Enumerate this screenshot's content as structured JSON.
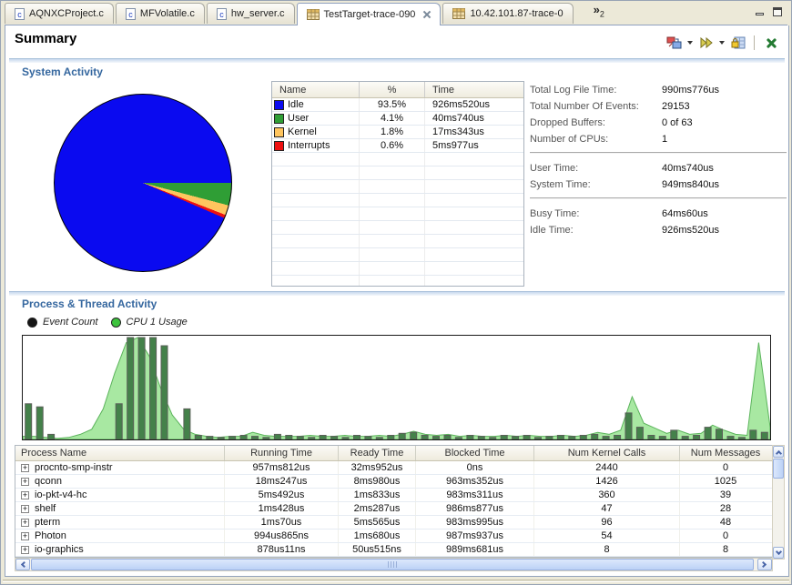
{
  "tab_bar": {
    "tabs": [
      {
        "label": "AQNXCProject.c",
        "icon": "c-file",
        "active": false,
        "closable": false
      },
      {
        "label": "MFVolatile.c",
        "icon": "c-file",
        "active": false,
        "closable": false
      },
      {
        "label": "hw_server.c",
        "icon": "c-file",
        "active": false,
        "closable": false
      },
      {
        "label": "TestTarget-trace-090",
        "icon": "trace",
        "active": true,
        "closable": true
      },
      {
        "label": "10.42.101.87-trace-0",
        "icon": "trace",
        "active": false,
        "closable": false
      }
    ],
    "overflow_count": "2"
  },
  "header": {
    "title": "Summary"
  },
  "system_activity": {
    "title": "System Activity",
    "legend_table": {
      "headers": [
        "Name",
        "%",
        "Time"
      ],
      "rows": [
        {
          "name": "Idle",
          "percent": "93.5%",
          "time": "926ms520us",
          "color": "#0a0af0"
        },
        {
          "name": "User",
          "percent": "4.1%",
          "time": "40ms740us",
          "color": "#2f9e35"
        },
        {
          "name": "Kernel",
          "percent": "1.8%",
          "time": "17ms343us",
          "color": "#ffc55e"
        },
        {
          "name": "Interrupts",
          "percent": "0.6%",
          "time": "5ms977us",
          "color": "#ee1010"
        }
      ],
      "empty_row_count": 10
    },
    "stats": {
      "groups": [
        [
          {
            "label": "Total Log File Time:",
            "value": "990ms776us"
          },
          {
            "label": "Total Number Of Events:",
            "value": "29153"
          },
          {
            "label": "Dropped Buffers:",
            "value": "0 of 63"
          },
          {
            "label": "Number of CPUs:",
            "value": "1"
          }
        ],
        [
          {
            "label": "User Time:",
            "value": "40ms740us"
          },
          {
            "label": "System Time:",
            "value": "949ms840us"
          }
        ],
        [
          {
            "label": "Busy Time:",
            "value": "64ms60us"
          },
          {
            "label": "Idle Time:",
            "value": "926ms520us"
          }
        ]
      ]
    }
  },
  "process_activity": {
    "title": "Process & Thread Activity",
    "legend": [
      {
        "label": "Event Count",
        "color": "#151515"
      },
      {
        "label": "CPU 1 Usage",
        "color": "#3ec43e"
      }
    ],
    "table": {
      "headers": [
        "Process Name",
        "Running Time",
        "Ready Time",
        "Blocked Time",
        "Num Kernel Calls",
        "Num Messages"
      ],
      "rows": [
        {
          "name": "procnto-smp-instr",
          "running": "957ms812us",
          "ready": "32ms952us",
          "blocked": "0ns",
          "kernel_calls": "2440",
          "messages": "0"
        },
        {
          "name": "qconn",
          "running": "18ms247us",
          "ready": "8ms980us",
          "blocked": "963ms352us",
          "kernel_calls": "1426",
          "messages": "1025"
        },
        {
          "name": "io-pkt-v4-hc",
          "running": "5ms492us",
          "ready": "1ms833us",
          "blocked": "983ms311us",
          "kernel_calls": "360",
          "messages": "39"
        },
        {
          "name": "shelf",
          "running": "1ms428us",
          "ready": "2ms287us",
          "blocked": "986ms877us",
          "kernel_calls": "47",
          "messages": "28"
        },
        {
          "name": "pterm",
          "running": "1ms70us",
          "ready": "5ms565us",
          "blocked": "983ms995us",
          "kernel_calls": "96",
          "messages": "48"
        },
        {
          "name": "Photon",
          "running": "994us865ns",
          "ready": "1ms680us",
          "blocked": "987ms937us",
          "kernel_calls": "54",
          "messages": "0"
        },
        {
          "name": "io-graphics",
          "running": "878us11ns",
          "ready": "50us515ns",
          "blocked": "989ms681us",
          "kernel_calls": "8",
          "messages": "8"
        }
      ]
    }
  },
  "chart_data": [
    {
      "type": "pie",
      "title": "System Activity CPU usage",
      "labels": [
        "Idle",
        "User",
        "Kernel",
        "Interrupts"
      ],
      "values": [
        93.5,
        4.1,
        1.8,
        0.6
      ],
      "colors": [
        "#0a0af0",
        "#2f9e35",
        "#ffc55e",
        "#ee1010"
      ],
      "unit": "%",
      "legend_position": "right-table",
      "start_angle_deg_from_east_clockwise": 0
    },
    {
      "type": "bar",
      "title": "Process & Thread Activity timeline",
      "note": "No axes or tick labels are visible; values are estimated percent of chart height over the trace timeline.",
      "ylim": [
        0,
        100
      ],
      "grid": false,
      "legend_position": "top-left",
      "series": [
        {
          "name": "Event Count",
          "type": "bar",
          "color": "#44814a",
          "values": [
            35,
            32,
            5,
            0,
            0,
            0,
            0,
            0,
            35,
            100,
            100,
            100,
            92,
            0,
            30,
            4,
            3,
            2,
            3,
            4,
            3,
            2,
            5,
            4,
            3,
            2,
            4,
            3,
            2,
            4,
            3,
            2,
            4,
            6,
            7,
            4,
            3,
            4,
            2,
            4,
            3,
            2,
            4,
            3,
            4,
            2,
            3,
            4,
            3,
            4,
            5,
            3,
            4,
            26,
            12,
            4,
            3,
            9,
            3,
            4,
            12,
            10,
            3,
            2,
            9,
            7
          ]
        },
        {
          "name": "CPU 1 Usage",
          "type": "area",
          "color": "#a8e8a2",
          "values": [
            3,
            3,
            2,
            1,
            2,
            5,
            10,
            30,
            65,
            95,
            100,
            82,
            50,
            24,
            10,
            5,
            3,
            2,
            3,
            3,
            7,
            4,
            3,
            3,
            3,
            4,
            3,
            3,
            4,
            3,
            3,
            4,
            3,
            5,
            8,
            5,
            4,
            5,
            3,
            4,
            3,
            3,
            4,
            3,
            4,
            3,
            3,
            4,
            3,
            4,
            7,
            5,
            9,
            42,
            16,
            11,
            6,
            9,
            5,
            6,
            14,
            9,
            5,
            4,
            95,
            12
          ]
        }
      ]
    }
  ]
}
